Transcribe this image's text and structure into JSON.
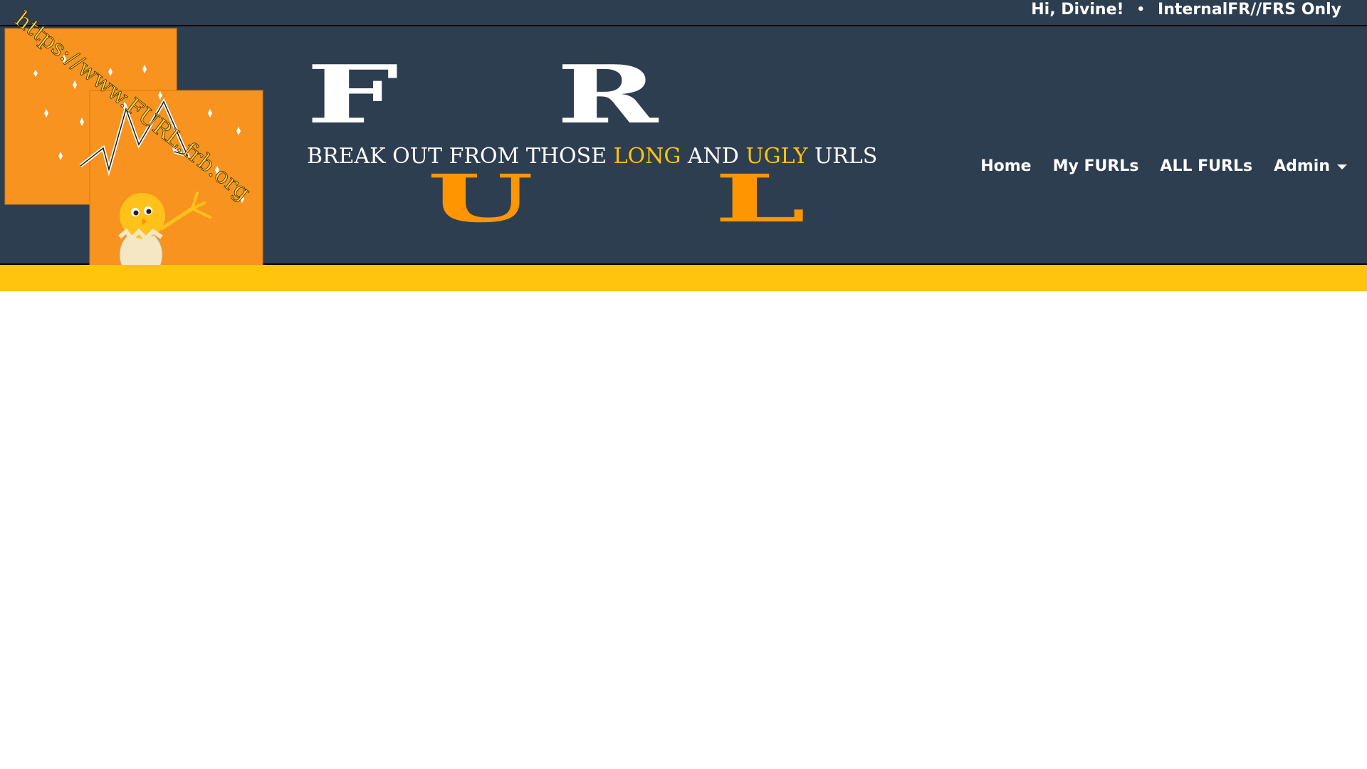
{
  "topbar": {
    "greeting": "Hi, Divine!",
    "separator": "•",
    "classification": "InternalFR//FRS Only"
  },
  "logo": {
    "url_text": "https://www.FURL.frb.org",
    "icon": "hatching-chick-icon"
  },
  "brand": {
    "letters": {
      "f": "F",
      "r": "R",
      "u": "U",
      "l": "L"
    },
    "tagline": {
      "part1": "BREAK OUT FROM THOSE ",
      "highlight1": "LONG",
      "part2": " AND ",
      "highlight2": "UGLY",
      "part3": " URLS"
    }
  },
  "nav": {
    "home": "Home",
    "my_furls": "My FURLs",
    "all_furls": "ALL FURLs",
    "admin": "Admin",
    "admin_icon": "caret-down-icon"
  },
  "colors": {
    "header_bg": "#2e3e51",
    "accent_orange": "#ff9600",
    "accent_gold": "#ffc40c",
    "logo_orange": "#f7931e",
    "text_light": "#ffffff"
  }
}
